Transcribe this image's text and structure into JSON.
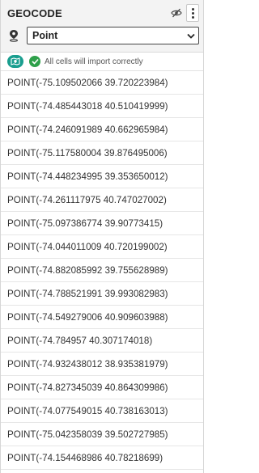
{
  "header": {
    "column_name": "GEOCODE",
    "hide_icon": "eye-slash-icon",
    "menu_icon": "vertical-dots-icon",
    "type_icon": "map-pin-icon",
    "type_select": {
      "selected": "Point"
    }
  },
  "status": {
    "badge_icon": "geocode-badge-icon",
    "check_icon": "check-circle-icon",
    "message": "All cells will import correctly",
    "colors": {
      "badge": "#1a9e8f",
      "check": "#2ea04a"
    }
  },
  "rows": [
    "POINT(-75.109502066 39.720223984)",
    "POINT(-74.485443018 40.510419999)",
    "POINT(-74.246091989 40.662965984)",
    "POINT(-75.117580004 39.876495006)",
    "POINT(-74.448234995 39.353650012)",
    "POINT(-74.261117975 40.747027002)",
    "POINT(-75.097386774 39.90773415)",
    "POINT(-74.044011009 40.720199002)",
    "POINT(-74.882085992 39.755628989)",
    "POINT(-74.788521991 39.993082983)",
    "POINT(-74.549279006 40.909603988)",
    "POINT(-74.784957 40.307174018)",
    "POINT(-74.932438012 38.935381979)",
    "POINT(-74.827345039 40.864309986)",
    "POINT(-74.077549015 40.738163013)",
    "POINT(-75.042358039 39.502727985)",
    "POINT(-74.154468986 40.78218699)"
  ]
}
